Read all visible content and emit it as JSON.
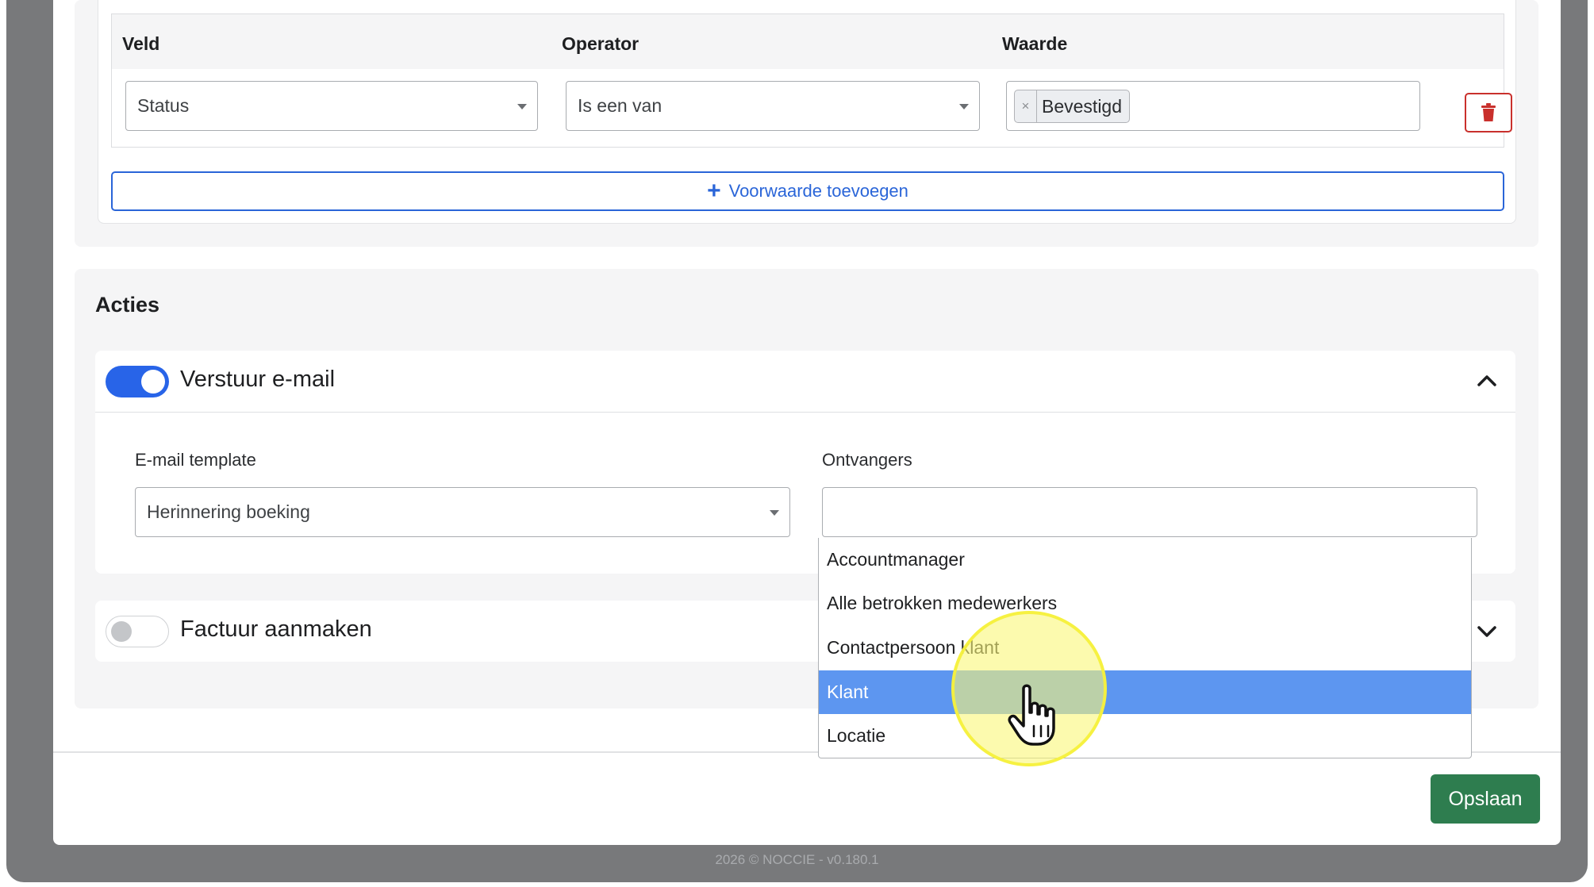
{
  "conditions": {
    "headers": {
      "field": "Veld",
      "operator": "Operator",
      "value": "Waarde"
    },
    "row": {
      "field": "Status",
      "operator": "Is een van",
      "value_tag": "Bevestigd",
      "tag_remove": "×"
    },
    "add_button": "Voorwaarde toevoegen",
    "add_icon": "+"
  },
  "acties": {
    "title": "Acties",
    "email_action": {
      "label": "Verstuur e-mail",
      "enabled": true,
      "expanded": true,
      "template_label": "E-mail template",
      "template_value": "Herinnering boeking",
      "recipients_label": "Ontvangers",
      "recipients_value": "",
      "recipients_options": [
        "Accountmanager",
        "Alle betrokken medewerkers",
        "Contactpersoon klant",
        "Klant",
        "Locatie"
      ],
      "highlighted_option": "Klant"
    },
    "invoice_action": {
      "label": "Factuur aanmaken",
      "enabled": false,
      "expanded": false
    }
  },
  "save_button": "Opslaan",
  "footer": "2026 © NOCCIE  - v0.180.1",
  "colors": {
    "primary": "#2864e8",
    "danger": "#c9302c",
    "success": "#2e7d4f",
    "highlight": "#5d96f0"
  },
  "icons": [
    "trash-icon",
    "plus-icon",
    "chevron-up-icon",
    "chevron-down-icon",
    "caret-down-icon",
    "hand-pointer-icon"
  ]
}
